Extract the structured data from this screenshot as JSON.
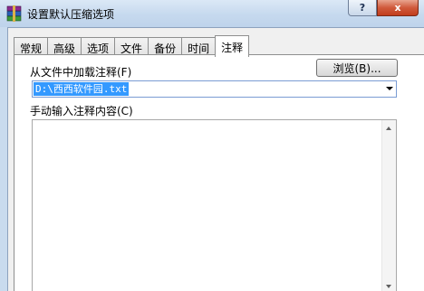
{
  "window": {
    "title": "设置默认压缩选项",
    "help_glyph": "?",
    "close_glyph": "x",
    "icon": "winrar-books-icon"
  },
  "tabs": [
    {
      "label": "常规",
      "active": false
    },
    {
      "label": "高级",
      "active": false
    },
    {
      "label": "选项",
      "active": false
    },
    {
      "label": "文件",
      "active": false
    },
    {
      "label": "备份",
      "active": false
    },
    {
      "label": "时间",
      "active": false
    },
    {
      "label": "注释",
      "active": true
    }
  ],
  "comment_panel": {
    "load_from_file_label": "从文件中加载注释(F)",
    "browse_button": "浏览(B)...",
    "file_path_value": "D:\\西西软件园.txt",
    "manual_input_label": "手动输入注释内容(C)",
    "comment_text": ""
  },
  "colors": {
    "selection": "#3399ff",
    "close_button": "#c13d1c",
    "titlebar": "#c6d9ee"
  }
}
